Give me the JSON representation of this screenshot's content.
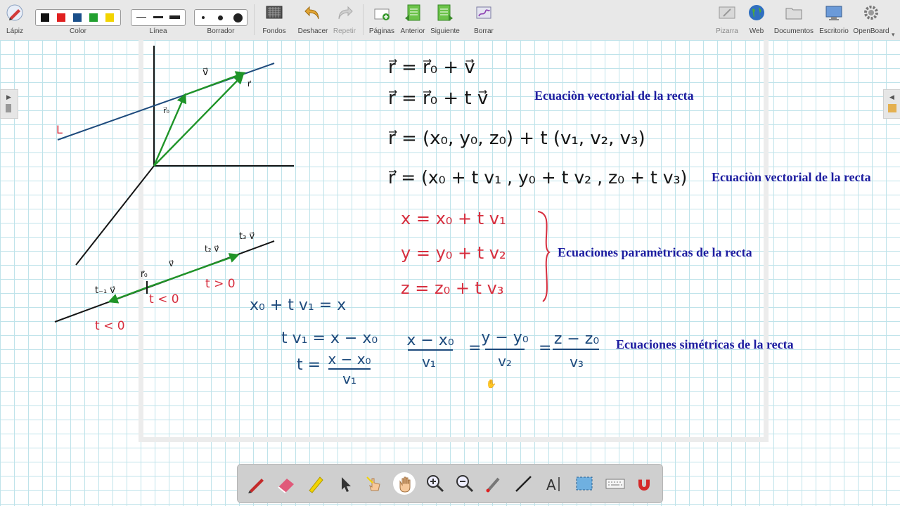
{
  "toolbar": {
    "pencil": "Lápiz",
    "color": "Color",
    "line": "Línea",
    "eraser": "Borrador",
    "backgrounds": "Fondos",
    "undo": "Deshacer",
    "redo": "Repetir",
    "pages": "Páginas",
    "previous": "Anterior",
    "next": "Siguiente",
    "clear": "Borrar",
    "board": "Pizarra",
    "web": "Web",
    "documents": "Documentos",
    "desktop": "Escritorio",
    "openboard": "OpenBoard"
  },
  "palette": [
    "#111111",
    "#e02020",
    "#1a4f8a",
    "#22a030",
    "#f2d400"
  ],
  "colors": {
    "handwriting_black": "#151515",
    "handwriting_blue": "#1d4a7c",
    "handwriting_red": "#d62e3e",
    "vector_green": "#1f9428",
    "typed_label": "#1d1da0",
    "grid": "#bfe3ea"
  },
  "board": {
    "labels": {
      "vector_equation_1": "Ecuaciòn vectorial de la recta",
      "vector_equation_2": "Ecuaciòn vectorial de la recta",
      "parametric_equations": "Ecuaciones paramètricas de la recta",
      "symmetric_equations": "Ecuaciones simétricas de la recta"
    },
    "handwriting": {
      "eq_r_sum": "r⃗ = r⃗₀ + v⃗",
      "eq_r_vector": "r⃗ = r⃗₀ + t v⃗",
      "eq_components": "r⃗ = (x₀, y₀, z₀) + t (v₁, v₂, v₃)",
      "eq_expanded": "r⃗ = (x₀ + t v₁ , y₀ + t v₂ , z₀ + t v₃)",
      "param_x": "x = x₀ + t v₁",
      "param_y": "y = y₀ + t v₂",
      "param_z": "z = z₀ + t v₃",
      "sym_x_num": "x − x₀",
      "sym_x_den": "v₁",
      "sym_y_num": "y − y₀",
      "sym_y_den": "v₂",
      "sym_z_num": "z − z₀",
      "sym_z_den": "v₃",
      "derive_1": "x₀ + t v₁ = x",
      "derive_2": "t v₁ = x − x₀",
      "derive_3_lhs": "t =",
      "derive_3_num": "x − x₀",
      "derive_3_den": "v₁",
      "line_L": "L",
      "vec_v": "v⃗",
      "vec_r0": "r⃗₀",
      "vec_r": "r⃗",
      "lbl_t_neg_v": "t₋₁ v⃗",
      "lbl_r0": "r⃗₀",
      "lbl_v": "v⃗",
      "lbl_2v": "t₂ v⃗",
      "lbl_3v": "t₃ v⃗",
      "cond_t_lt0_a": "t < 0",
      "cond_t_lt0_b": "t < 0",
      "cond_t_gt0": "t > 0"
    }
  },
  "dock_tools": [
    "pen-icon",
    "eraser-icon",
    "highlighter-icon",
    "selector-icon",
    "interact-icon",
    "hand-icon",
    "zoom-in-icon",
    "zoom-out-icon",
    "laser-pointer-icon",
    "line-icon",
    "text-icon",
    "capture-icon",
    "keyboard-icon",
    "magnet-icon"
  ]
}
